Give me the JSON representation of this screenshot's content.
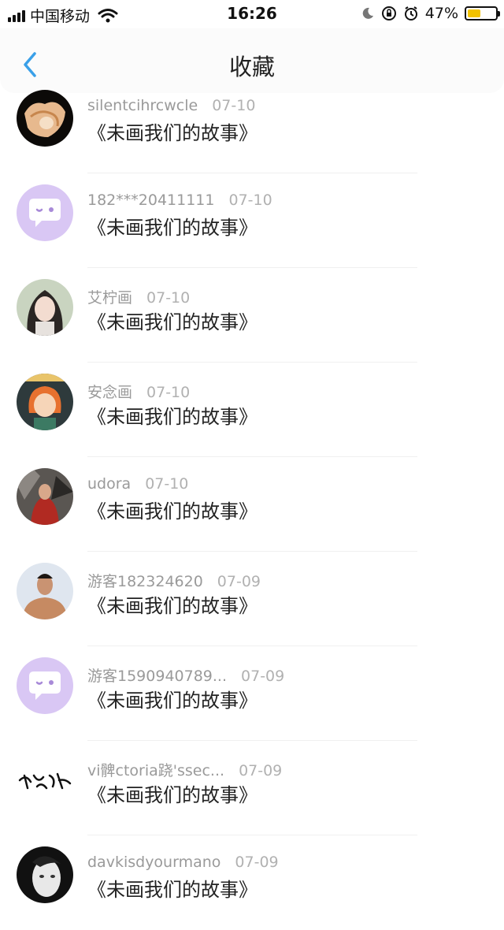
{
  "status_bar": {
    "carrier": "中国移动",
    "time": "16:26",
    "battery": "47%",
    "battery_level": 0.47,
    "battery_color": "#f2c200"
  },
  "header": {
    "title": "收藏",
    "back_icon": "chevron-left-icon",
    "accent_color": "#3aa0e8"
  },
  "items": [
    {
      "user": "silentcihrcwcle",
      "date": "07-10",
      "title": "《未画我们的故事》",
      "avatar": "shell"
    },
    {
      "user": "182***20411111",
      "date": "07-10",
      "title": "《未画我们的故事》",
      "avatar": "chat-bubble"
    },
    {
      "user": "艾柠画",
      "date": "07-10",
      "title": "《未画我们的故事》",
      "avatar": "girl-photo"
    },
    {
      "user": "安念画",
      "date": "07-10",
      "title": "《未画我们的故事》",
      "avatar": "cartoon-girl"
    },
    {
      "user": "udora",
      "date": "07-10",
      "title": "《未画我们的故事》",
      "avatar": "painting"
    },
    {
      "user": "游客182324620",
      "date": "07-09",
      "title": "《未画我们的故事》",
      "avatar": "man-photo"
    },
    {
      "user": "游客1590940789...",
      "date": "07-09",
      "title": "《未画我们的故事》",
      "avatar": "chat-bubble"
    },
    {
      "user": "vi髀ctoria跷'ssec...",
      "date": "07-09",
      "title": "《未画我们的故事》",
      "avatar": "calligraphy"
    },
    {
      "user": "davkisdyourmano",
      "date": "07-09",
      "title": "《未画我们的故事》",
      "avatar": "face-bw"
    }
  ]
}
